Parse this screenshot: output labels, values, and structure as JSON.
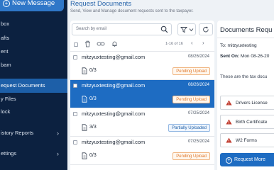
{
  "sidebar": {
    "new_message": "New Message",
    "items": [
      {
        "label": "box",
        "chevron": false
      },
      {
        "label": "afts",
        "chevron": false
      },
      {
        "label": "ent",
        "chevron": false
      },
      {
        "label": "bam",
        "chevron": false
      },
      {
        "label": "equest Documents",
        "chevron": false,
        "active": true
      },
      {
        "label": "y Files",
        "chevron": false
      },
      {
        "label": "lock",
        "chevron": false
      },
      {
        "label": "istory Reports",
        "chevron": true
      },
      {
        "label": "ettings",
        "chevron": true
      }
    ]
  },
  "header": {
    "title": "Request Documents",
    "subtitle": "Send, View and Manage document requests sent to the taxpayer."
  },
  "list": {
    "search_placeholder": "Search by email",
    "pagination": "1-16 of 16",
    "rows": [
      {
        "email": "mitzyuxtesting@gmail.com",
        "date": "08/26/2024",
        "count": "0/3",
        "status": "Pending Upload",
        "status_type": "pending"
      },
      {
        "email": "mitzyuxtesting@gmail.com",
        "date": "08/26/2024",
        "count": "0/3",
        "status": "Pending Upload",
        "status_type": "pending",
        "selected": true
      },
      {
        "email": "mitzyuxtesting@gmail.com",
        "date": "07/25/2024",
        "count": "3/3",
        "status": "Partially Uploaded",
        "status_type": "partial"
      },
      {
        "email": "mitzyuxtesting@gmail.com",
        "date": "07/25/2024",
        "count": "0/3",
        "status": "Pending Upload",
        "status_type": "pending"
      }
    ]
  },
  "detail": {
    "title": "Documents Requ",
    "to_label": "To:",
    "to_value": "mitzyuxtesting",
    "sent_label": "Sent On:",
    "sent_value": "Mon 08-26-20",
    "body": "These are the tax docu",
    "documents": [
      "Drivers License",
      "Birth Certificate",
      "W2 Forms"
    ],
    "request_more": "Request More"
  },
  "colors": {
    "sidebar_bg": "#0c2140",
    "accent": "#1e6cc2",
    "pending": "#e07a2f",
    "partial": "#2563a9",
    "warning": "#c0392b"
  }
}
